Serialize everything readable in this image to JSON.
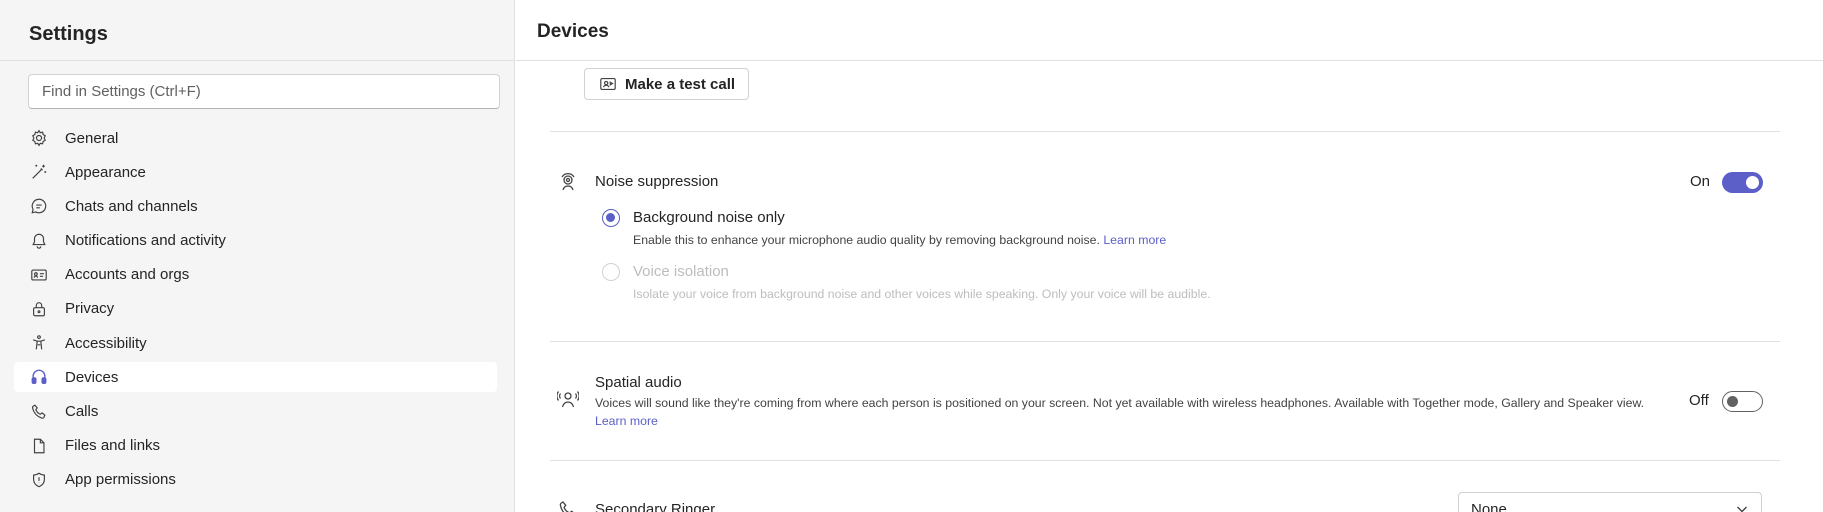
{
  "sidebar": {
    "title": "Settings",
    "search_placeholder": "Find in Settings (Ctrl+F)",
    "items": [
      {
        "label": "General",
        "icon": "gear-icon"
      },
      {
        "label": "Appearance",
        "icon": "magic-wand-icon"
      },
      {
        "label": "Chats and channels",
        "icon": "chat-icon"
      },
      {
        "label": "Notifications and activity",
        "icon": "bell-icon"
      },
      {
        "label": "Accounts and orgs",
        "icon": "contact-card-icon"
      },
      {
        "label": "Privacy",
        "icon": "lock-icon"
      },
      {
        "label": "Accessibility",
        "icon": "accessibility-icon"
      },
      {
        "label": "Devices",
        "icon": "headset-icon"
      },
      {
        "label": "Calls",
        "icon": "phone-icon"
      },
      {
        "label": "Files and links",
        "icon": "document-icon"
      },
      {
        "label": "App permissions",
        "icon": "shield-icon"
      }
    ]
  },
  "main": {
    "title": "Devices",
    "test_call_label": "Make a test call",
    "noise": {
      "title": "Noise suppression",
      "toggle_label": "On",
      "toggle_on": true,
      "option1_label": "Background noise only",
      "option1_desc": "Enable this to enhance your microphone audio quality by removing background noise.",
      "option1_link": "Learn more",
      "option2_label": "Voice isolation",
      "option2_desc": "Isolate your voice from background noise and other voices while speaking. Only your voice will be audible."
    },
    "spatial": {
      "title": "Spatial audio",
      "desc": "Voices will sound like they're coming from where each person is positioned on your screen. Not yet available with wireless headphones. Available with Together mode, Gallery and Speaker view.",
      "link": "Learn more",
      "toggle_label": "Off",
      "toggle_on": false
    },
    "ringer": {
      "title": "Secondary Ringer",
      "value": "None"
    }
  },
  "colors": {
    "accent": "#5b5fc7",
    "sidebar_bg": "#f5f5f5"
  }
}
